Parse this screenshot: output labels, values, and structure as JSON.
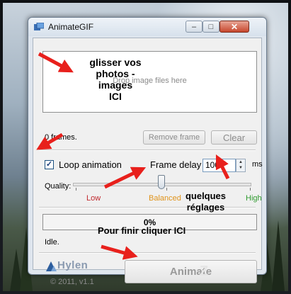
{
  "window": {
    "title": "AnimateGIF",
    "minimize_glyph": "–",
    "maximize_glyph": "□",
    "close_glyph": "✕"
  },
  "drop_zone": {
    "hint": "Drop image files here"
  },
  "frames": {
    "count_label": "0 frames.",
    "remove_frame_label": "Remove frame",
    "clear_label": "Clear"
  },
  "settings": {
    "loop_label": "Loop animation",
    "loop_checked": true,
    "check_glyph": "✓",
    "frame_delay_label": "Frame delay",
    "frame_delay_value": "100",
    "frame_delay_unit": "ms",
    "quality_label": "Quality:",
    "quality_options": [
      "Low",
      "Balanced",
      "High"
    ],
    "quality_selected": "Balanced",
    "quality_level": 0.5
  },
  "progress": {
    "value_percent": 0,
    "text": "0%"
  },
  "status": "Idle.",
  "footer": {
    "logo_text": "Hylen",
    "copyright": "© 2011, v1.1",
    "animate_label": "Animate"
  },
  "annotations": {
    "drop_note": [
      "glisser vos",
      "photos -",
      "images",
      "ICI"
    ],
    "settings_note": [
      "quelques",
      "réglages"
    ],
    "finish_note": "Pour finir cliquer ICI"
  },
  "colors": {
    "quality_low": "#c0282d",
    "quality_balanced": "#e0931a",
    "quality_high": "#2f9a2f",
    "arrow": "#e8201c"
  },
  "icons": {
    "app": "animategif-app-icon",
    "logo": "hylen-logo-icon"
  }
}
